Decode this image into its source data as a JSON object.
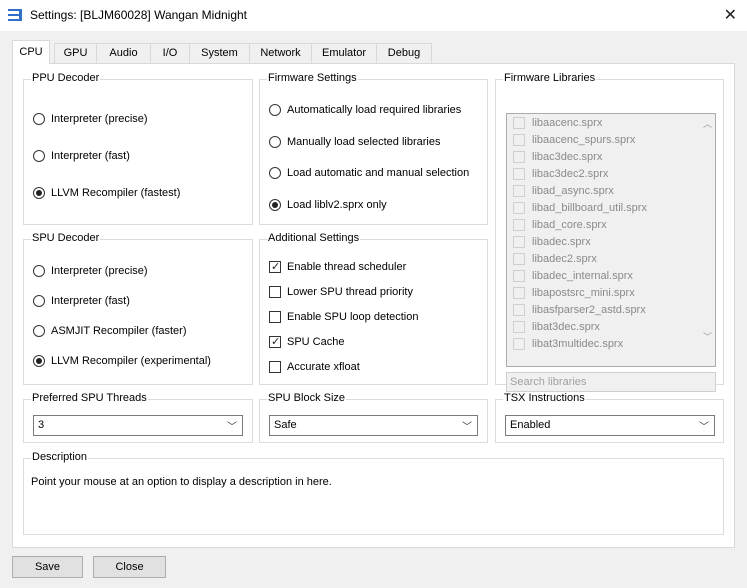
{
  "window": {
    "title": "Settings: [BLJM60028] Wangan Midnight",
    "close": "✕"
  },
  "tabs": [
    {
      "label": "CPU"
    },
    {
      "label": "GPU"
    },
    {
      "label": "Audio"
    },
    {
      "label": "I/O"
    },
    {
      "label": "System"
    },
    {
      "label": "Network"
    },
    {
      "label": "Emulator"
    },
    {
      "label": "Debug"
    }
  ],
  "ppu_decoder": {
    "title": "PPU Decoder",
    "options": [
      "Interpreter (precise)",
      "Interpreter (fast)",
      "LLVM Recompiler (fastest)"
    ],
    "selected": 2
  },
  "firmware_settings": {
    "title": "Firmware Settings",
    "options": [
      "Automatically load required libraries",
      "Manually load selected libraries",
      "Load automatic and manual selection",
      "Load liblv2.sprx only"
    ],
    "selected": 3
  },
  "firmware_libraries": {
    "title": "Firmware Libraries",
    "items": [
      "libaacenc.sprx",
      "libaacenc_spurs.sprx",
      "libac3dec.sprx",
      "libac3dec2.sprx",
      "libad_async.sprx",
      "libad_billboard_util.sprx",
      "libad_core.sprx",
      "libadec.sprx",
      "libadec2.sprx",
      "libadec_internal.sprx",
      "libapostsrc_mini.sprx",
      "libasfparser2_astd.sprx",
      "libat3dec.sprx",
      "libat3multidec.sprx"
    ],
    "search_placeholder": "Search libraries"
  },
  "spu_decoder": {
    "title": "SPU Decoder",
    "options": [
      "Interpreter (precise)",
      "Interpreter (fast)",
      "ASMJIT Recompiler (faster)",
      "LLVM Recompiler (experimental)"
    ],
    "selected": 3
  },
  "additional_settings": {
    "title": "Additional Settings",
    "options": [
      {
        "label": "Enable thread scheduler",
        "checked": true
      },
      {
        "label": "Lower SPU thread priority",
        "checked": false
      },
      {
        "label": "Enable SPU loop detection",
        "checked": false
      },
      {
        "label": "SPU Cache",
        "checked": true
      },
      {
        "label": "Accurate xfloat",
        "checked": false
      }
    ]
  },
  "preferred_spu_threads": {
    "title": "Preferred SPU Threads",
    "value": "3"
  },
  "spu_block_size": {
    "title": "SPU Block Size",
    "value": "Safe"
  },
  "tsx_instructions": {
    "title": "TSX Instructions",
    "value": "Enabled"
  },
  "description": {
    "title": "Description",
    "text": "Point your mouse at an option to display a description in here."
  },
  "footer": {
    "save": "Save",
    "close": "Close"
  },
  "icons": {
    "combo_arrow": "chevron-down-icon",
    "app": "app-icon"
  }
}
